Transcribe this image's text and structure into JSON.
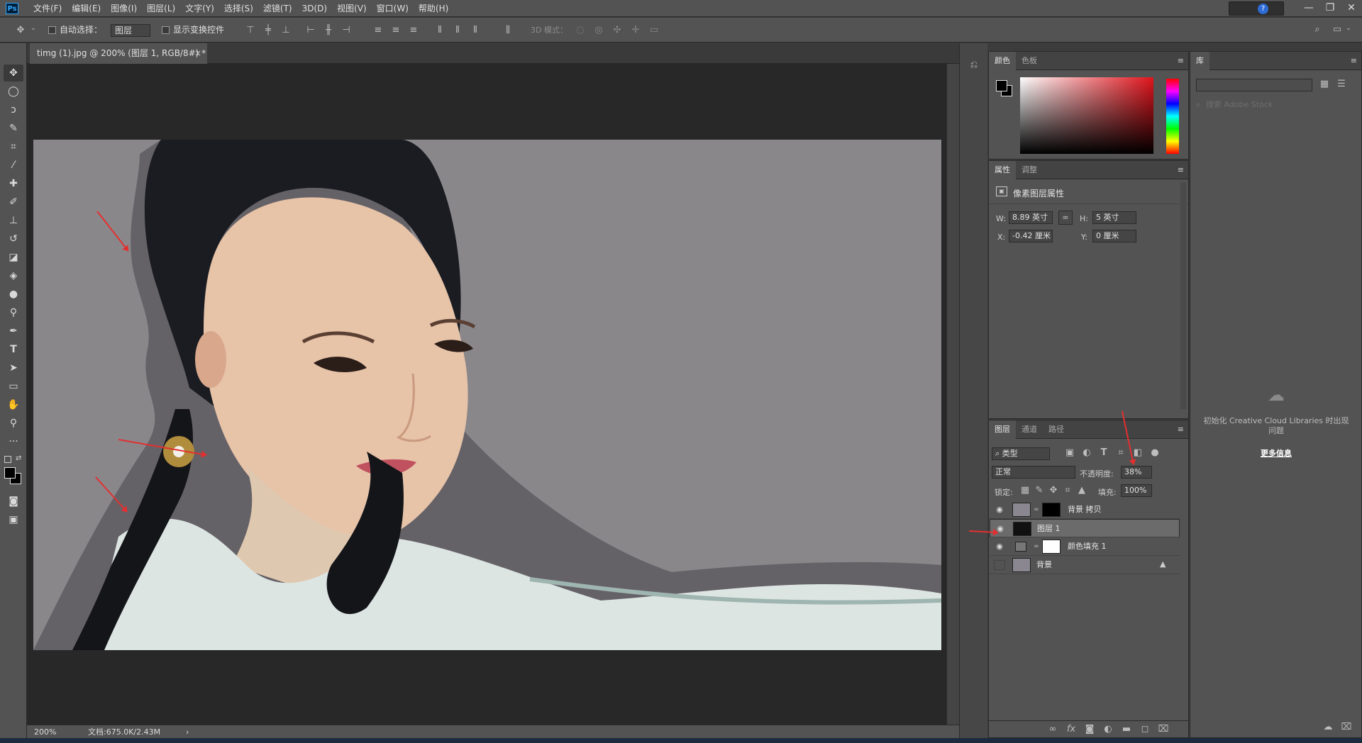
{
  "app": {
    "logo": "Ps"
  },
  "menubar": {
    "items": [
      "文件(F)",
      "编辑(E)",
      "图像(I)",
      "图层(L)",
      "文字(Y)",
      "选择(S)",
      "滤镜(T)",
      "3D(D)",
      "视图(V)",
      "窗口(W)",
      "帮助(H)"
    ],
    "help": "?"
  },
  "window_controls": {
    "minimize": "—",
    "restore": "❐",
    "close": "✕"
  },
  "options": {
    "auto_select_label": "自动选择：",
    "auto_select_value": "图层",
    "show_transform_label": "显示变换控件",
    "mode_3d_label": "3D 模式："
  },
  "document": {
    "tab_title": "timg (1).jpg @ 200% (图层 1, RGB/8#) *",
    "tab_close": "×"
  },
  "status": {
    "zoom": "200%",
    "doc_info": "文档:675.0K/2.43M",
    "arrow": "›"
  },
  "color_panel": {
    "tabs": [
      "颜色",
      "色板"
    ]
  },
  "properties_panel": {
    "tabs": [
      "属性",
      "调整"
    ],
    "heading": "像素图层属性",
    "w_label": "W:",
    "w_value": "8.89 英寸",
    "h_label": "H:",
    "h_value": "5 英寸",
    "x_label": "X:",
    "x_value": "-0.42 厘米",
    "y_label": "Y:",
    "y_value": "0 厘米"
  },
  "layers_panel": {
    "tabs": [
      "图层",
      "通道",
      "路径"
    ],
    "filter_kind": "类型",
    "blend_mode": "正常",
    "opacity_label": "不透明度:",
    "opacity_value": "38%",
    "lock_label": "锁定:",
    "fill_label": "填充:",
    "fill_value": "100%",
    "layers": [
      {
        "name": "背景 拷贝",
        "visible": true
      },
      {
        "name": "图层 1",
        "visible": true,
        "selected": true
      },
      {
        "name": "颜色填充 1",
        "visible": true
      },
      {
        "name": "背景",
        "visible": false,
        "locked": true
      }
    ],
    "footer_icons": [
      "link-icon",
      "fx-icon",
      "mask-icon",
      "adjustment-icon",
      "group-icon",
      "new-layer-icon",
      "trash-icon"
    ],
    "fx": "fx"
  },
  "library_panel": {
    "tab": "库",
    "search_placeholder": "搜索 Adobe Stock",
    "message": "初始化 Creative Cloud Libraries 时出现问题",
    "more_info": "更多信息"
  },
  "colors": {
    "accent": "#31a8ff",
    "annotation_arrow": "#e23030",
    "canvas_background": "#8a878b"
  }
}
